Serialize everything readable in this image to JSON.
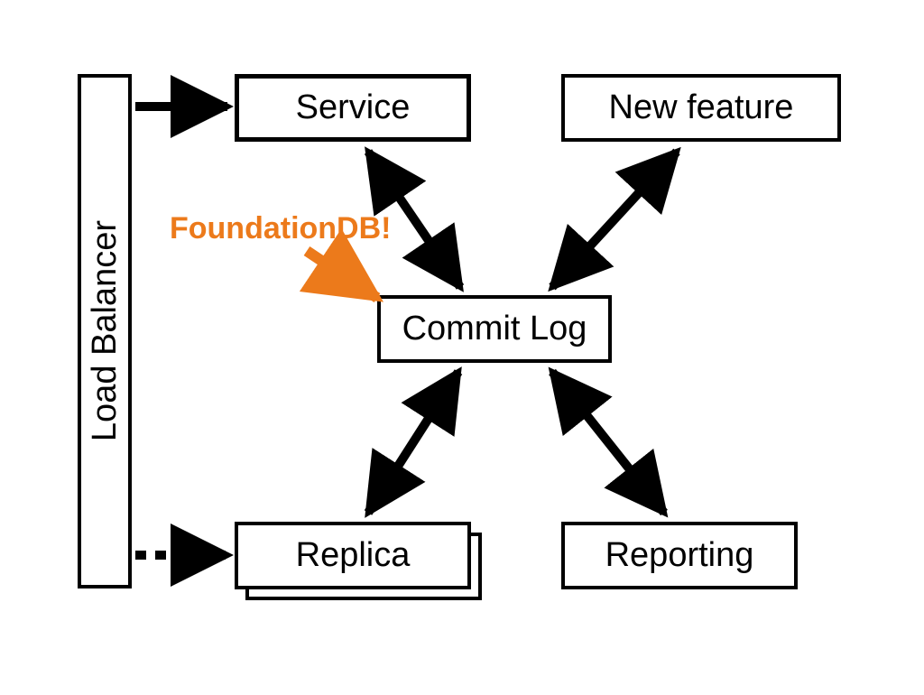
{
  "nodes": {
    "load_balancer": "Load Balancer",
    "service": "Service",
    "new_feature": "New feature",
    "commit_log": "Commit Log",
    "replica": "Replica",
    "reporting": "Reporting"
  },
  "callout": "FoundationDB!",
  "colors": {
    "accent": "#ec7a1b",
    "stroke": "#000000"
  },
  "edges": [
    {
      "from": "load_balancer",
      "to": "service",
      "style": "solid-single"
    },
    {
      "from": "load_balancer",
      "to": "replica",
      "style": "dashed-single"
    },
    {
      "from": "service",
      "to": "commit_log",
      "style": "solid-double"
    },
    {
      "from": "new_feature",
      "to": "commit_log",
      "style": "solid-double"
    },
    {
      "from": "replica",
      "to": "commit_log",
      "style": "solid-double"
    },
    {
      "from": "reporting",
      "to": "commit_log",
      "style": "solid-double"
    },
    {
      "from": "callout",
      "to": "commit_log",
      "style": "accent-single"
    }
  ]
}
